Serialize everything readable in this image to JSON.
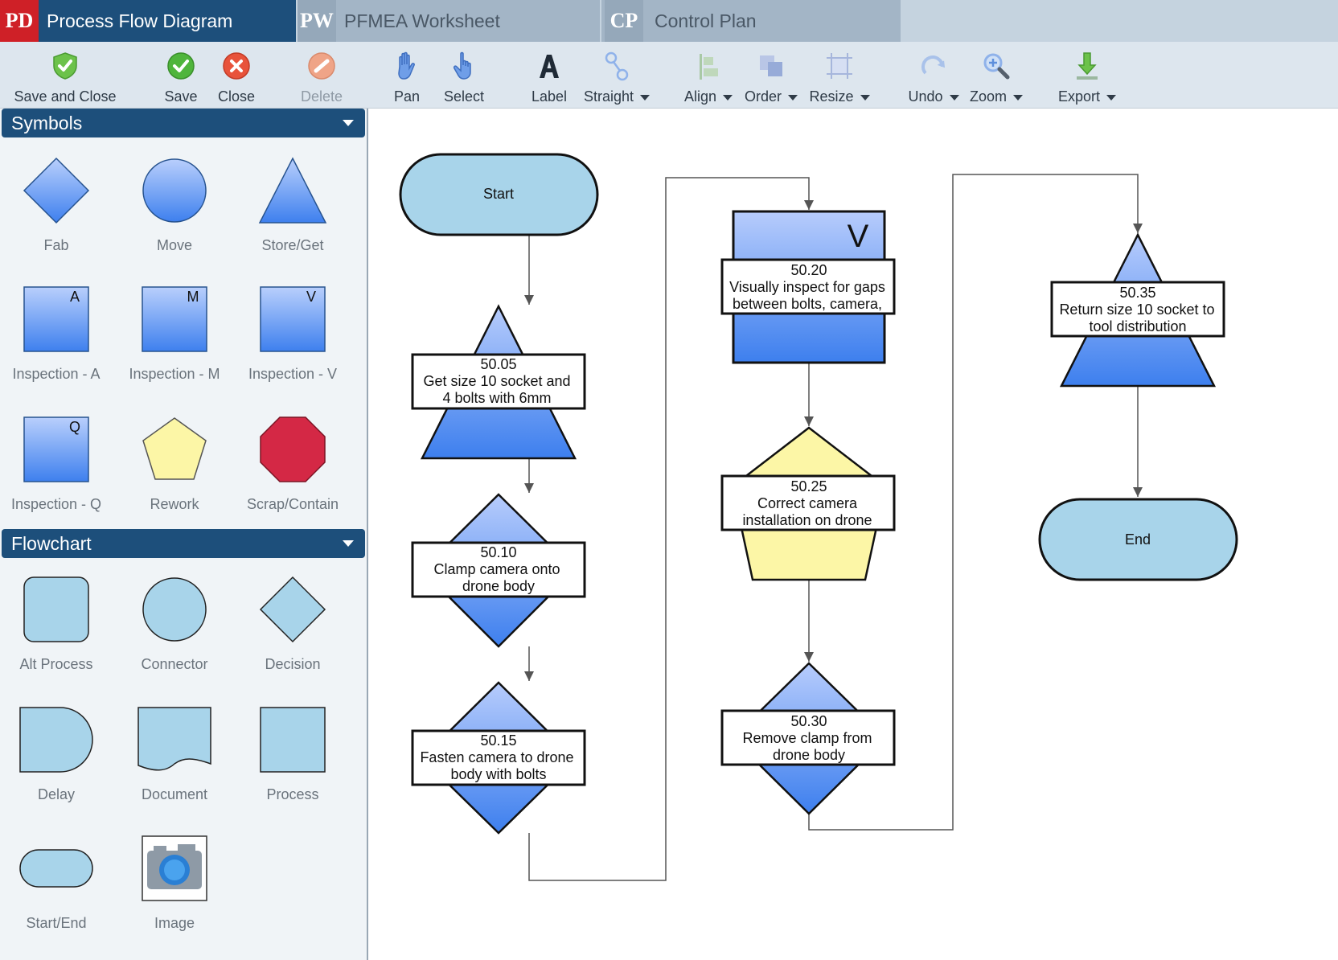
{
  "tabs": [
    {
      "badge": "PD",
      "label": "Process Flow Diagram"
    },
    {
      "badge": "PW",
      "label": "PFMEA Worksheet"
    },
    {
      "badge": "CP",
      "label": "Control Plan"
    }
  ],
  "toolbar": {
    "save_close": "Save and Close",
    "save": "Save",
    "close": "Close",
    "delete": "Delete",
    "pan": "Pan",
    "select": "Select",
    "label": "Label",
    "straight": "Straight",
    "align": "Align",
    "order": "Order",
    "resize": "Resize",
    "undo": "Undo",
    "zoom": "Zoom",
    "export": "Export"
  },
  "icons": {
    "save_close": "shield-check-icon",
    "save": "check-circle-icon",
    "close": "x-circle-icon",
    "delete": "no-entry-icon",
    "pan": "hand-icon",
    "select": "pointer-hand-icon",
    "label": "letter-a-icon",
    "straight": "connector-line-icon",
    "align": "align-icon",
    "order": "order-icon",
    "resize": "resize-icon",
    "undo": "undo-icon",
    "zoom": "zoom-icon",
    "export": "download-icon"
  },
  "sidebar": {
    "symbols": {
      "title": "Symbols",
      "items": [
        {
          "label": "Fab"
        },
        {
          "label": "Move"
        },
        {
          "label": "Store/Get"
        },
        {
          "label": "Inspection - A",
          "letter": "A"
        },
        {
          "label": "Inspection - M",
          "letter": "M"
        },
        {
          "label": "Inspection - V",
          "letter": "V"
        },
        {
          "label": "Inspection - Q",
          "letter": "Q"
        },
        {
          "label": "Rework"
        },
        {
          "label": "Scrap/Contain"
        }
      ]
    },
    "flowchart": {
      "title": "Flowchart",
      "items": [
        {
          "label": "Alt Process"
        },
        {
          "label": "Connector"
        },
        {
          "label": "Decision"
        },
        {
          "label": "Delay"
        },
        {
          "label": "Document"
        },
        {
          "label": "Process"
        },
        {
          "label": "Start/End"
        },
        {
          "label": "Image"
        }
      ]
    }
  },
  "diagram": {
    "start": "Start",
    "end": "End",
    "steps": [
      {
        "num": "50.05",
        "line1": "Get size 10 socket and",
        "line2": "4 bolts with 6mm"
      },
      {
        "num": "50.10",
        "line1": "Clamp camera onto",
        "line2": "drone body"
      },
      {
        "num": "50.15",
        "line1": "Fasten camera to drone",
        "line2": "body with bolts"
      },
      {
        "num": "50.20",
        "line1": "Visually inspect for gaps",
        "line2": "between bolts, camera,",
        "letter": "V"
      },
      {
        "num": "50.25",
        "line1": "Correct camera",
        "line2": "installation on drone"
      },
      {
        "num": "50.30",
        "line1": "Remove clamp from",
        "line2": "drone body"
      },
      {
        "num": "50.35",
        "line1": "Return size 10 socket to",
        "line2": "tool distribution"
      }
    ]
  },
  "colors": {
    "brand_dark": "#1d4f7b",
    "brand_red": "#cf2027",
    "terminal_fill": "#a8d4ea",
    "symbol_blue_top": "#b6cdfc",
    "symbol_blue_bottom": "#3f82ee",
    "rework_yellow": "#fcf6a6",
    "scrap_red": "#d42845"
  }
}
